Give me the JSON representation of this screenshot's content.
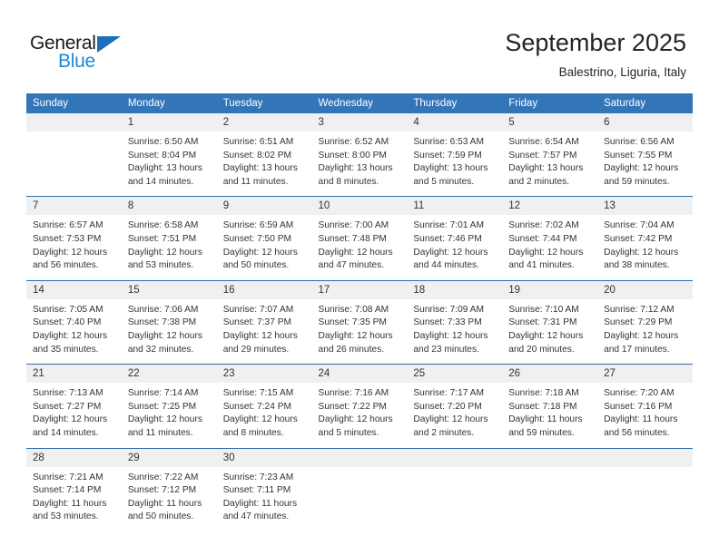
{
  "brand": {
    "name_part1": "General",
    "name_part2": "Blue",
    "triangle_icon": "triangle-icon",
    "accent_dark": "#1e6fb8",
    "accent_light": "#1e88d6"
  },
  "header": {
    "title": "September 2025",
    "subtitle": "Balestrino, Liguria, Italy"
  },
  "theme": {
    "header_blue": "#3275b8",
    "row_separator_blue": "#2f6cad",
    "daynum_band": "#f0f0f0",
    "text": "#333333"
  },
  "calendar": {
    "columns": [
      "Sunday",
      "Monday",
      "Tuesday",
      "Wednesday",
      "Thursday",
      "Friday",
      "Saturday"
    ],
    "weeks": [
      [
        {
          "day": "",
          "lines": []
        },
        {
          "day": "1",
          "lines": [
            "Sunrise: 6:50 AM",
            "Sunset: 8:04 PM",
            "Daylight: 13 hours",
            "and 14 minutes."
          ]
        },
        {
          "day": "2",
          "lines": [
            "Sunrise: 6:51 AM",
            "Sunset: 8:02 PM",
            "Daylight: 13 hours",
            "and 11 minutes."
          ]
        },
        {
          "day": "3",
          "lines": [
            "Sunrise: 6:52 AM",
            "Sunset: 8:00 PM",
            "Daylight: 13 hours",
            "and 8 minutes."
          ]
        },
        {
          "day": "4",
          "lines": [
            "Sunrise: 6:53 AM",
            "Sunset: 7:59 PM",
            "Daylight: 13 hours",
            "and 5 minutes."
          ]
        },
        {
          "day": "5",
          "lines": [
            "Sunrise: 6:54 AM",
            "Sunset: 7:57 PM",
            "Daylight: 13 hours",
            "and 2 minutes."
          ]
        },
        {
          "day": "6",
          "lines": [
            "Sunrise: 6:56 AM",
            "Sunset: 7:55 PM",
            "Daylight: 12 hours",
            "and 59 minutes."
          ]
        }
      ],
      [
        {
          "day": "7",
          "lines": [
            "Sunrise: 6:57 AM",
            "Sunset: 7:53 PM",
            "Daylight: 12 hours",
            "and 56 minutes."
          ]
        },
        {
          "day": "8",
          "lines": [
            "Sunrise: 6:58 AM",
            "Sunset: 7:51 PM",
            "Daylight: 12 hours",
            "and 53 minutes."
          ]
        },
        {
          "day": "9",
          "lines": [
            "Sunrise: 6:59 AM",
            "Sunset: 7:50 PM",
            "Daylight: 12 hours",
            "and 50 minutes."
          ]
        },
        {
          "day": "10",
          "lines": [
            "Sunrise: 7:00 AM",
            "Sunset: 7:48 PM",
            "Daylight: 12 hours",
            "and 47 minutes."
          ]
        },
        {
          "day": "11",
          "lines": [
            "Sunrise: 7:01 AM",
            "Sunset: 7:46 PM",
            "Daylight: 12 hours",
            "and 44 minutes."
          ]
        },
        {
          "day": "12",
          "lines": [
            "Sunrise: 7:02 AM",
            "Sunset: 7:44 PM",
            "Daylight: 12 hours",
            "and 41 minutes."
          ]
        },
        {
          "day": "13",
          "lines": [
            "Sunrise: 7:04 AM",
            "Sunset: 7:42 PM",
            "Daylight: 12 hours",
            "and 38 minutes."
          ]
        }
      ],
      [
        {
          "day": "14",
          "lines": [
            "Sunrise: 7:05 AM",
            "Sunset: 7:40 PM",
            "Daylight: 12 hours",
            "and 35 minutes."
          ]
        },
        {
          "day": "15",
          "lines": [
            "Sunrise: 7:06 AM",
            "Sunset: 7:38 PM",
            "Daylight: 12 hours",
            "and 32 minutes."
          ]
        },
        {
          "day": "16",
          "lines": [
            "Sunrise: 7:07 AM",
            "Sunset: 7:37 PM",
            "Daylight: 12 hours",
            "and 29 minutes."
          ]
        },
        {
          "day": "17",
          "lines": [
            "Sunrise: 7:08 AM",
            "Sunset: 7:35 PM",
            "Daylight: 12 hours",
            "and 26 minutes."
          ]
        },
        {
          "day": "18",
          "lines": [
            "Sunrise: 7:09 AM",
            "Sunset: 7:33 PM",
            "Daylight: 12 hours",
            "and 23 minutes."
          ]
        },
        {
          "day": "19",
          "lines": [
            "Sunrise: 7:10 AM",
            "Sunset: 7:31 PM",
            "Daylight: 12 hours",
            "and 20 minutes."
          ]
        },
        {
          "day": "20",
          "lines": [
            "Sunrise: 7:12 AM",
            "Sunset: 7:29 PM",
            "Daylight: 12 hours",
            "and 17 minutes."
          ]
        }
      ],
      [
        {
          "day": "21",
          "lines": [
            "Sunrise: 7:13 AM",
            "Sunset: 7:27 PM",
            "Daylight: 12 hours",
            "and 14 minutes."
          ]
        },
        {
          "day": "22",
          "lines": [
            "Sunrise: 7:14 AM",
            "Sunset: 7:25 PM",
            "Daylight: 12 hours",
            "and 11 minutes."
          ]
        },
        {
          "day": "23",
          "lines": [
            "Sunrise: 7:15 AM",
            "Sunset: 7:24 PM",
            "Daylight: 12 hours",
            "and 8 minutes."
          ]
        },
        {
          "day": "24",
          "lines": [
            "Sunrise: 7:16 AM",
            "Sunset: 7:22 PM",
            "Daylight: 12 hours",
            "and 5 minutes."
          ]
        },
        {
          "day": "25",
          "lines": [
            "Sunrise: 7:17 AM",
            "Sunset: 7:20 PM",
            "Daylight: 12 hours",
            "and 2 minutes."
          ]
        },
        {
          "day": "26",
          "lines": [
            "Sunrise: 7:18 AM",
            "Sunset: 7:18 PM",
            "Daylight: 11 hours",
            "and 59 minutes."
          ]
        },
        {
          "day": "27",
          "lines": [
            "Sunrise: 7:20 AM",
            "Sunset: 7:16 PM",
            "Daylight: 11 hours",
            "and 56 minutes."
          ]
        }
      ],
      [
        {
          "day": "28",
          "lines": [
            "Sunrise: 7:21 AM",
            "Sunset: 7:14 PM",
            "Daylight: 11 hours",
            "and 53 minutes."
          ]
        },
        {
          "day": "29",
          "lines": [
            "Sunrise: 7:22 AM",
            "Sunset: 7:12 PM",
            "Daylight: 11 hours",
            "and 50 minutes."
          ]
        },
        {
          "day": "30",
          "lines": [
            "Sunrise: 7:23 AM",
            "Sunset: 7:11 PM",
            "Daylight: 11 hours",
            "and 47 minutes."
          ]
        },
        {
          "day": "",
          "lines": []
        },
        {
          "day": "",
          "lines": []
        },
        {
          "day": "",
          "lines": []
        },
        {
          "day": "",
          "lines": []
        }
      ]
    ]
  }
}
